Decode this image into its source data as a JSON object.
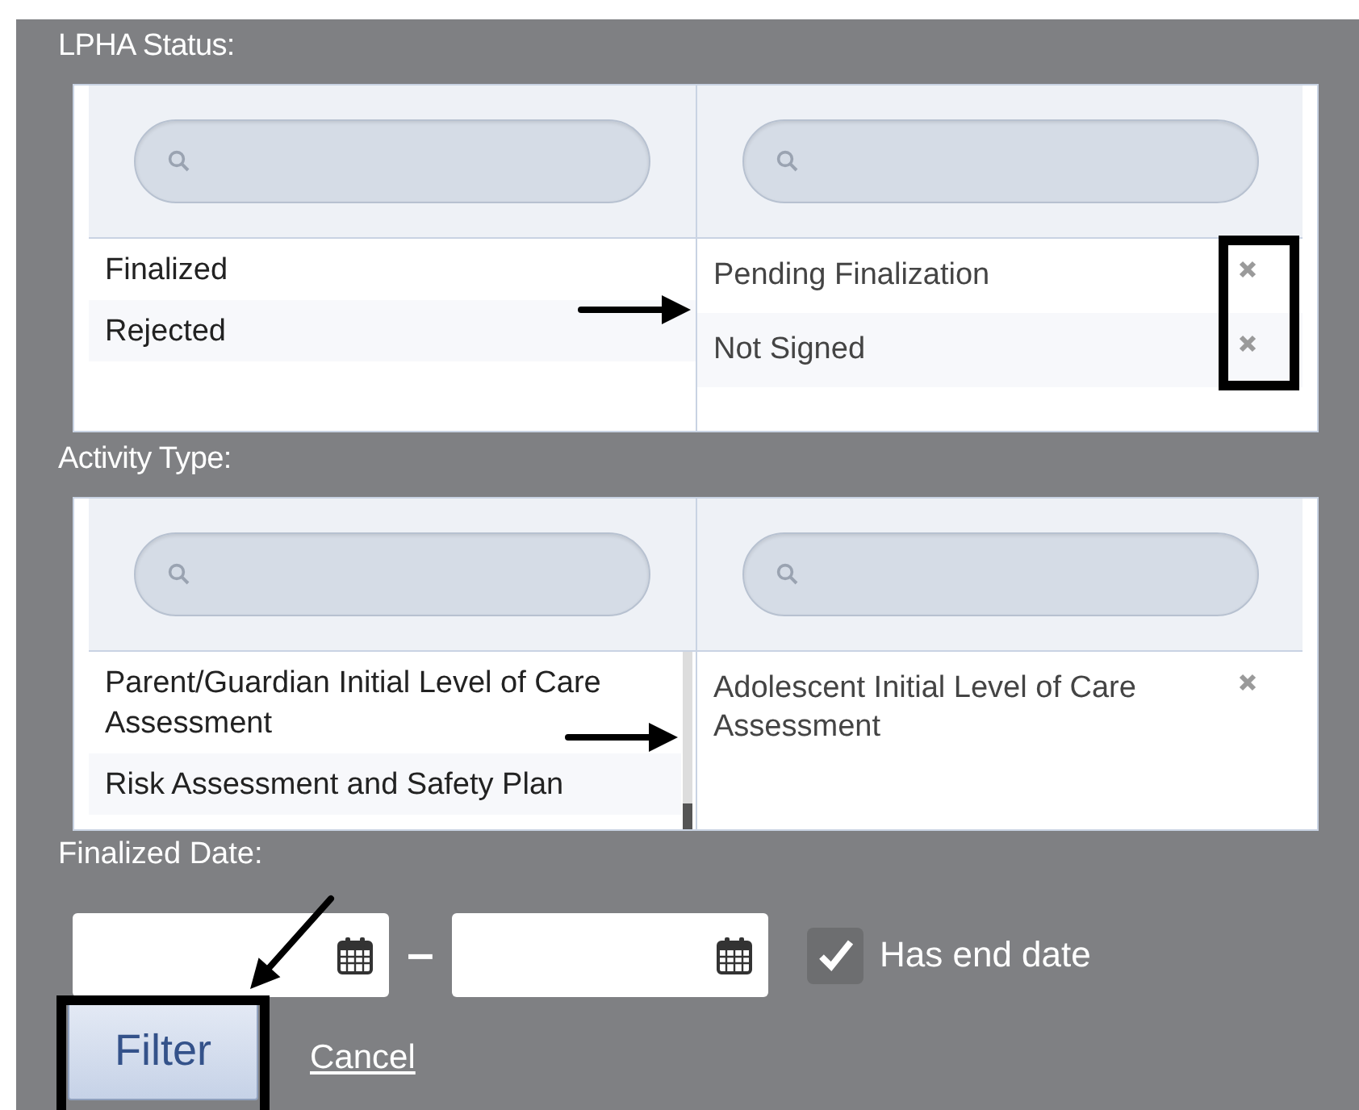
{
  "lpha_status": {
    "label": "LPHA Status:",
    "available": [
      {
        "label": "Finalized"
      },
      {
        "label": "Rejected"
      }
    ],
    "chosen": [
      {
        "label": "Pending Finalization"
      },
      {
        "label": "Not Signed"
      }
    ]
  },
  "activity_type": {
    "label": "Activity Type:",
    "available": [
      {
        "label": "Parent/Guardian Initial Level of Care Assessment"
      },
      {
        "label": "Risk Assessment and Safety Plan"
      }
    ],
    "chosen": [
      {
        "label": "Adolescent Initial Level of Care Assessment"
      }
    ]
  },
  "finalized_date": {
    "label": "Finalized Date:",
    "separator": "–",
    "has_end_date": {
      "label": "Has end date",
      "checked": true
    }
  },
  "buttons": [
    {
      "kind": "primary",
      "label": "Filter"
    },
    {
      "kind": "link",
      "label": "Cancel"
    }
  ],
  "annotations": [
    {
      "kind": "arrow"
    },
    {
      "kind": "box"
    },
    {
      "kind": "arrow"
    },
    {
      "kind": "arrow"
    },
    {
      "kind": "box"
    }
  ]
}
